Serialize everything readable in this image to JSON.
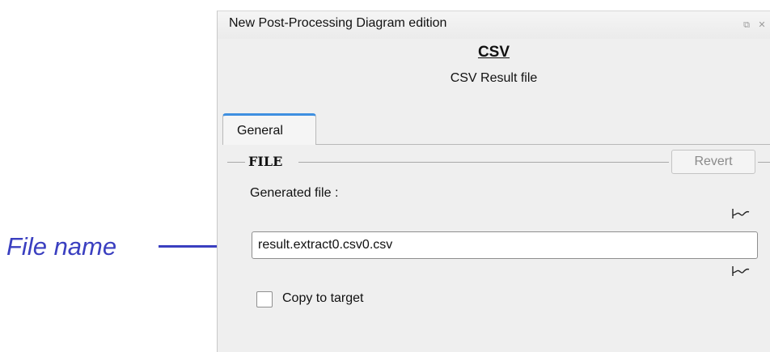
{
  "annotation": {
    "text": "File name",
    "color": "#3a3fc0"
  },
  "window": {
    "title": "New Post-Processing Diagram edition",
    "float_button_icon": "float-icon",
    "close_button_icon": "close-icon"
  },
  "header": {
    "title": "CSV",
    "subtitle": "CSV Result file"
  },
  "tabs": [
    {
      "label": "General",
      "active": true
    }
  ],
  "file_group": {
    "title": "FILE",
    "revert_label": "Revert",
    "generated_label": "Generated file :",
    "filename_value": "result.extract0.csv0.csv",
    "wave_icon": "waveform-icon",
    "copy_label": "Copy to target",
    "copy_checked": false
  },
  "colors": {
    "tab_accent": "#3e8fe0",
    "panel_bg": "#efefef"
  }
}
